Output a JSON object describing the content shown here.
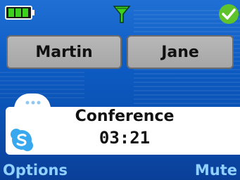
{
  "status_bar": {
    "battery_icon": "battery-full-icon",
    "signal_icon": "signal-antenna-icon",
    "presence_icon": "online-check-icon"
  },
  "participants": [
    {
      "name": "Martin"
    },
    {
      "name": "Jane"
    }
  ],
  "call": {
    "title": "Conference",
    "duration": "03:21",
    "app_icon": "skype-logo-icon"
  },
  "softkeys": {
    "left": "Options",
    "right": "Mute"
  },
  "colors": {
    "background": "#0d5cc4",
    "softkey_text": "#8fd0ff",
    "battery_green": "#3cd11c",
    "presence_green": "#5fc42b"
  }
}
